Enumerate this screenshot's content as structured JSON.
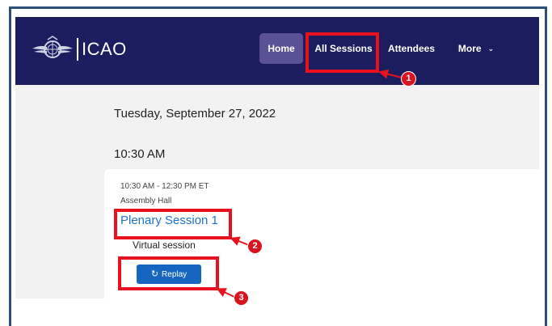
{
  "brand": {
    "name": "ICAO",
    "logo_icon": "icao-emblem-icon"
  },
  "nav": {
    "items": [
      {
        "label": "Home"
      },
      {
        "label": "All Sessions"
      },
      {
        "label": "Attendees"
      },
      {
        "label": "More"
      }
    ],
    "more_icon": "chevron-down-icon"
  },
  "schedule": {
    "date": "Tuesday, September 27, 2022",
    "time_slot": "10:30 AM",
    "session": {
      "time_range": "10:30 AM - 12:30 PM ET",
      "location": "Assembly Hall",
      "title": "Plenary Session 1",
      "type": "Virtual session",
      "replay_label": "Replay",
      "replay_icon": "replay-icon"
    }
  },
  "annotations": {
    "color": "#e8121e",
    "steps": [
      "1",
      "2",
      "3"
    ]
  },
  "colors": {
    "navbar": "#1b1d5e",
    "nav_active": "#5a5295",
    "link": "#1f73c6",
    "button": "#1665c1",
    "frame": "#2c4f7c"
  }
}
